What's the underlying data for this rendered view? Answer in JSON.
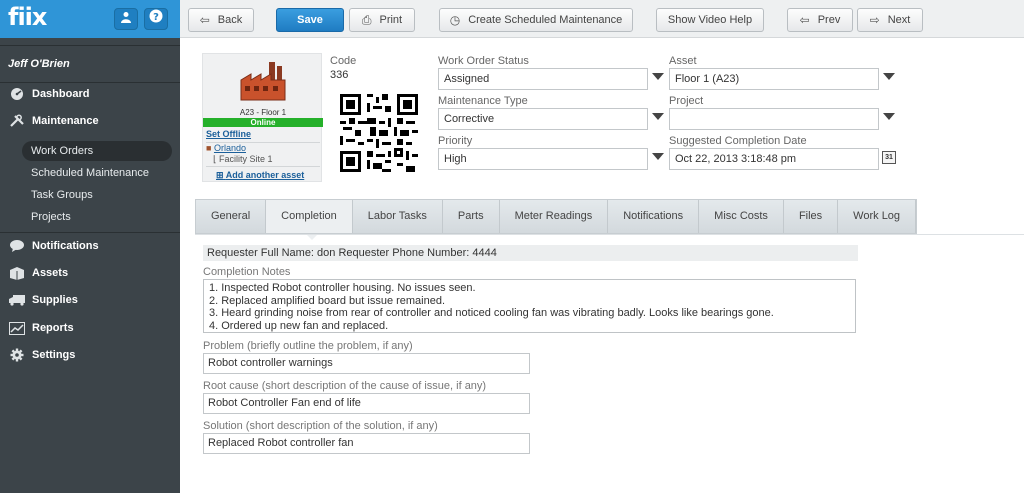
{
  "app": {
    "logo": "fiix",
    "user_icon": "person-icon",
    "help_icon": "question-icon"
  },
  "user": {
    "name": "Jeff O'Brien"
  },
  "nav": [
    {
      "label": "Dashboard",
      "icon": "dashboard-icon"
    },
    {
      "label": "Maintenance",
      "icon": "tools-icon"
    },
    {
      "label": "Notifications",
      "icon": "speech-bubble-icon"
    },
    {
      "label": "Assets",
      "icon": "assets-icon"
    },
    {
      "label": "Supplies",
      "icon": "truck-icon"
    },
    {
      "label": "Reports",
      "icon": "chart-icon"
    },
    {
      "label": "Settings",
      "icon": "gear-icon"
    }
  ],
  "maintenance_sub": [
    "Work Orders",
    "Scheduled Maintenance",
    "Task Groups",
    "Projects"
  ],
  "toolbar": {
    "back": "Back",
    "save": "Save",
    "print": "Print",
    "create_sm": "Create Scheduled Maintenance",
    "video_help": "Show Video Help",
    "prev": "Prev",
    "next": "Next"
  },
  "asset_card": {
    "caption": "A23 - Floor 1",
    "status": "Online",
    "set_offline": "Set Offline",
    "location": "Orlando",
    "site": "Facility Site 1",
    "add_asset": "Add another asset"
  },
  "work_order": {
    "code_label": "Code",
    "code": "336",
    "status_label": "Work Order Status",
    "status": "Assigned",
    "type_label": "Maintenance Type",
    "type": "Corrective",
    "priority_label": "Priority",
    "priority": "High",
    "asset_label": "Asset",
    "asset": "Floor 1 (A23)",
    "project_label": "Project",
    "project": "",
    "completion_date_label": "Suggested Completion Date",
    "completion_date": "Oct 22, 2013 3:18:48 pm",
    "calendar_icon_text": "31"
  },
  "tabs": [
    "General",
    "Completion",
    "Labor Tasks",
    "Parts",
    "Meter Readings",
    "Notifications",
    "Misc Costs",
    "Files",
    "Work Log"
  ],
  "active_tab": "Completion",
  "completion": {
    "requester": "Requester Full Name: don Requester Phone Number: 4444",
    "notes_label": "Completion Notes",
    "notes": [
      "1. Inspected Robot controller housing. No issues seen.",
      "2. Replaced amplified board but issue remained.",
      "3. Heard grinding noise from rear of controller and noticed cooling fan was vibrating badly. Looks like bearings gone.",
      "4. Ordered up new fan and replaced."
    ],
    "problem_label": "Problem (briefly outline the problem, if any)",
    "problem": "Robot controller warnings",
    "root_cause_label": "Root cause (short description of the cause of issue, if any)",
    "root_cause": "Robot Controller Fan end of life",
    "solution_label": "Solution (short description of the solution, if any)",
    "solution": "Replaced Robot controller fan"
  },
  "colors": {
    "brand": "#2f95d7",
    "sidebar": "#3c4449",
    "online": "#25b02a",
    "link": "#1b5f9a"
  }
}
